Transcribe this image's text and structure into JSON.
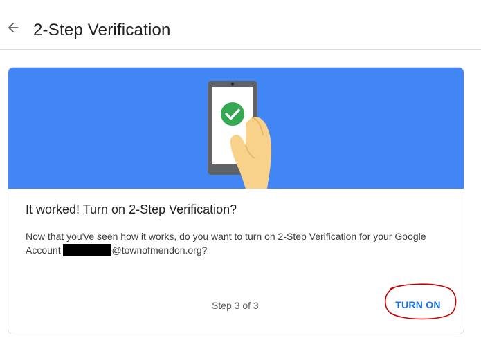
{
  "header": {
    "back_icon": "arrow-back-icon",
    "title": "2-Step Verification"
  },
  "card": {
    "hero": {
      "background_color": "#4285f4",
      "illustration": "phone-with-checkmark-illustration",
      "check_color": "#34a853"
    },
    "heading": "It worked! Turn on 2-Step Verification?",
    "body_prefix": "Now that you've seen how it works, do you want to turn on 2-Step Verification for your Google Account ",
    "email_domain": "@townofmendon.org?",
    "step_text": "Step 3 of 3",
    "primary_button": "TURN ON",
    "accent_color": "#1a73e8",
    "annotation_color": "#cc0000"
  }
}
